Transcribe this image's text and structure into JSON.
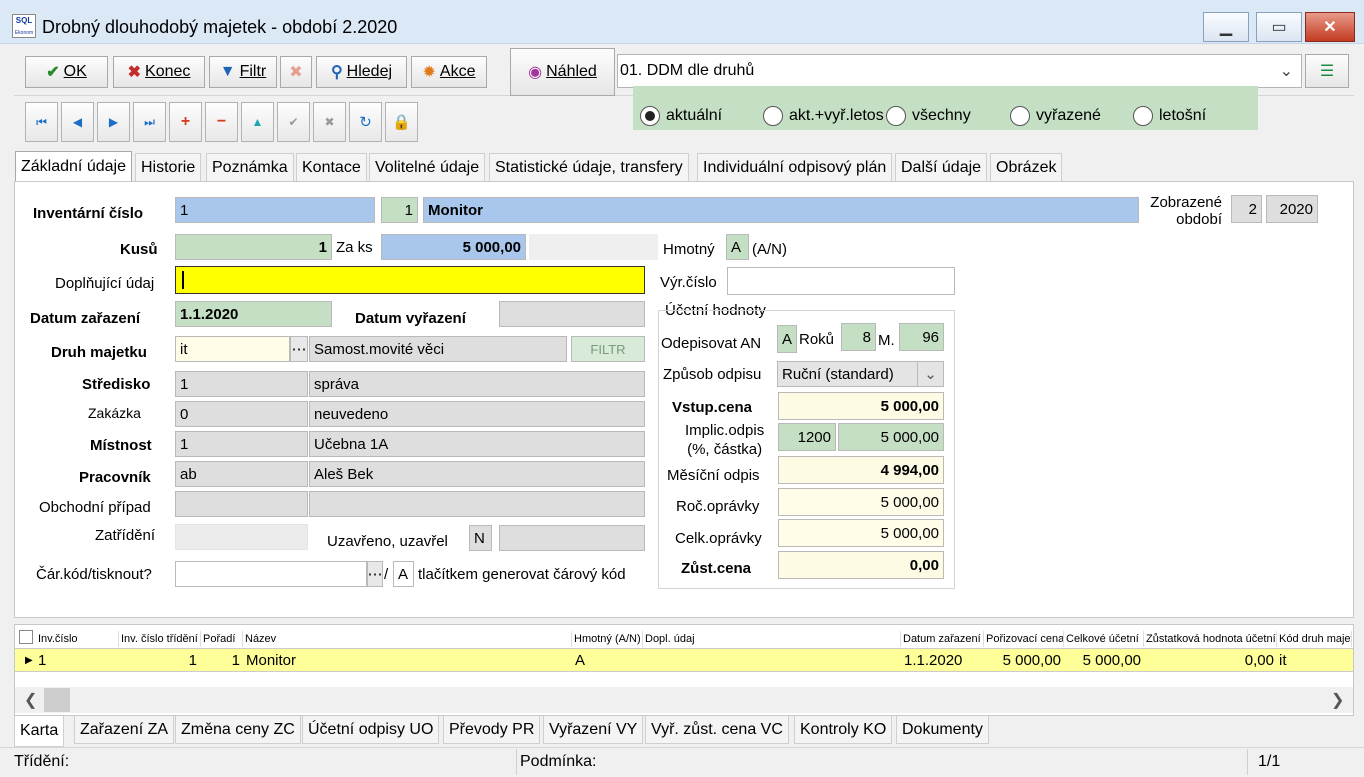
{
  "window": {
    "logo": "SQL",
    "logo_sub": "Ekonom",
    "title": "Drobný dlouhodobý majetek - období 2.2020"
  },
  "toolbar": {
    "ok": "OK",
    "konec": "Konec",
    "filtr": "Filtr",
    "hledej": "Hledej",
    "akce": "Akce",
    "nahled": "Náhled",
    "report": "01. DDM dle druhů"
  },
  "radios": [
    {
      "label": "aktuální",
      "checked": true
    },
    {
      "label": "akt.+vyř.letos",
      "checked": false
    },
    {
      "label": "všechny",
      "checked": false
    },
    {
      "label": "vyřazené",
      "checked": false
    },
    {
      "label": "letošní",
      "checked": false
    }
  ],
  "tabs": [
    "Základní údaje",
    "Historie",
    "Poznámka",
    "Kontace",
    "Volitelné údaje",
    "Statistické údaje, transfery",
    "Individuální odpisový plán",
    "Další údaje",
    "Obrázek"
  ],
  "form": {
    "inv_label": "Inventární číslo",
    "inv_value": "1",
    "inv_seq": "1",
    "inv_name": "Monitor",
    "period_label1": "Zobrazené",
    "period_label2": "období",
    "period_month": "2",
    "period_year": "2020",
    "kusu_label": "Kusů",
    "kusu_value": "1",
    "zaks_label": "Za ks",
    "zaks_value": "5 000,00",
    "hmotny_label": "Hmotný",
    "hmotny_value": "A",
    "hmotny_hint": "(A/N)",
    "dopl_label": "Doplňující údaj",
    "dopl_value": "",
    "vyr_label": "Výr.číslo",
    "vyr_value": "",
    "datum_zar_label": "Datum zařazení",
    "datum_zar_value": "1.1.2020",
    "datum_vyr_label": "Datum vyřazení",
    "datum_vyr_value": "",
    "druh_label": "Druh majetku",
    "druh_code": "it",
    "druh_name": "Samost.movité věci",
    "filtr_btn": "FILTR",
    "stredisko_label": "Středisko",
    "stredisko_code": "1",
    "stredisko_name": "správa",
    "zakazka_label": "Zakázka",
    "zakazka_code": "0",
    "zakazka_name": "neuvedeno",
    "mistnost_label": "Místnost",
    "mistnost_code": "1",
    "mistnost_name": "Učebna 1A",
    "pracovnik_label": "Pracovník",
    "pracovnik_code": "ab",
    "pracovnik_name": "Aleš Bek",
    "obchod_label": "Obchodní případ",
    "zatrideni_label": "Zatřídění",
    "uzavreno_label": "Uzavřeno, uzavřel",
    "uzavreno_value": "N",
    "carkod_label": "Čár.kód/tisknout?",
    "carkod_flag": "A",
    "carkod_hint": "tlačítkem generovat čárový kód",
    "ucetni_title": "Účetní hodnoty",
    "odepisovat_label": "Odepisovat AN",
    "odepisovat_value": "A",
    "roku_label": "Roků",
    "roku_value": "8",
    "m_label": "M.",
    "m_value": "96",
    "zpusob_label": "Způsob odpisu",
    "zpusob_value": "Ruční (standard)",
    "vstup_label": "Vstup.cena",
    "vstup_value": "5 000,00",
    "implic_label1": "Implic.odpis",
    "implic_label2": "(%, částka)",
    "implic_pct": "1200",
    "implic_amount": "5 000,00",
    "mesicni_label": "Měsíční odpis",
    "mesicni_value": "4 994,00",
    "roc_label": "Roč.oprávky",
    "roc_value": "5 000,00",
    "celk_label": "Celk.oprávky",
    "celk_value": "5 000,00",
    "zust_label": "Zůst.cena",
    "zust_value": "0,00"
  },
  "grid": {
    "headers": [
      "Inv.číslo",
      "Inv. číslo třídění",
      "Pořadí",
      "Název",
      "Hmotný (A/N)",
      "Dopl. údaj",
      "Datum zařazení",
      "Pořizovací cena",
      "Celkové účetní",
      "Zůstatková hodnota účetní",
      "Kód druh majet"
    ],
    "row": [
      "1",
      "1",
      "1",
      "Monitor",
      "A",
      "",
      "1.1.2020",
      "5 000,00",
      "5 000,00",
      "0,00",
      "it"
    ]
  },
  "bottom_tabs": [
    "Karta",
    "Zařazení ZA",
    "Změna ceny ZC",
    "Účetní odpisy UO",
    "Převody PR",
    "Vyřazení VY",
    "Vyř. zůst. cena VC",
    "Kontroly KO",
    "Dokumenty"
  ],
  "status": {
    "trideni": "Třídění:",
    "podminka": "Podmínka:",
    "page": "1/1"
  }
}
